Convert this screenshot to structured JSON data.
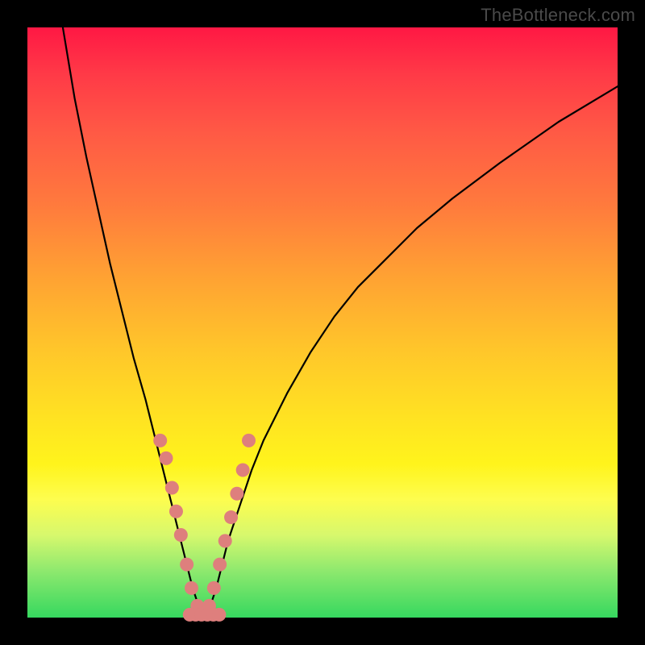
{
  "watermark": {
    "text": "TheBottleneck.com"
  },
  "chart_data": {
    "type": "line",
    "title": "",
    "xlabel": "",
    "ylabel": "",
    "xlim": [
      0,
      100
    ],
    "ylim": [
      0,
      100
    ],
    "grid": false,
    "legend": false,
    "series": [
      {
        "name": "curve",
        "color": "#000000",
        "x": [
          6,
          8,
          10,
          12,
          14,
          16,
          18,
          20,
          22,
          24,
          25,
          26,
          27,
          28,
          29,
          30,
          31,
          32,
          33,
          34,
          36,
          38,
          40,
          44,
          48,
          52,
          56,
          60,
          66,
          72,
          80,
          90,
          100
        ],
        "y": [
          100,
          88,
          78,
          69,
          60,
          52,
          44,
          37,
          29,
          21,
          17,
          13,
          9,
          5,
          2,
          0,
          2,
          5,
          9,
          13,
          19,
          25,
          30,
          38,
          45,
          51,
          56,
          60,
          66,
          71,
          77,
          84,
          90
        ]
      },
      {
        "name": "dots-left",
        "type": "scatter",
        "color": "#de7f7d",
        "x": [
          22.5,
          23.5,
          24.5,
          25.2,
          26.0,
          27.0,
          27.8,
          28.8,
          29.8
        ],
        "y": [
          30,
          27,
          22,
          18,
          14,
          9,
          5,
          2,
          1
        ]
      },
      {
        "name": "dots-right",
        "type": "scatter",
        "color": "#de7f7d",
        "x": [
          30.8,
          31.6,
          32.6,
          33.5,
          34.5,
          35.5,
          36.5,
          37.5
        ],
        "y": [
          2,
          5,
          9,
          13,
          17,
          21,
          25,
          30
        ]
      },
      {
        "name": "dots-bottom",
        "type": "scatter",
        "color": "#de7f7d",
        "x": [
          27.5,
          28.5,
          29.5,
          30.5,
          31.5,
          32.5
        ],
        "y": [
          0.5,
          0.5,
          0.5,
          0.5,
          0.5,
          0.5
        ]
      }
    ]
  }
}
